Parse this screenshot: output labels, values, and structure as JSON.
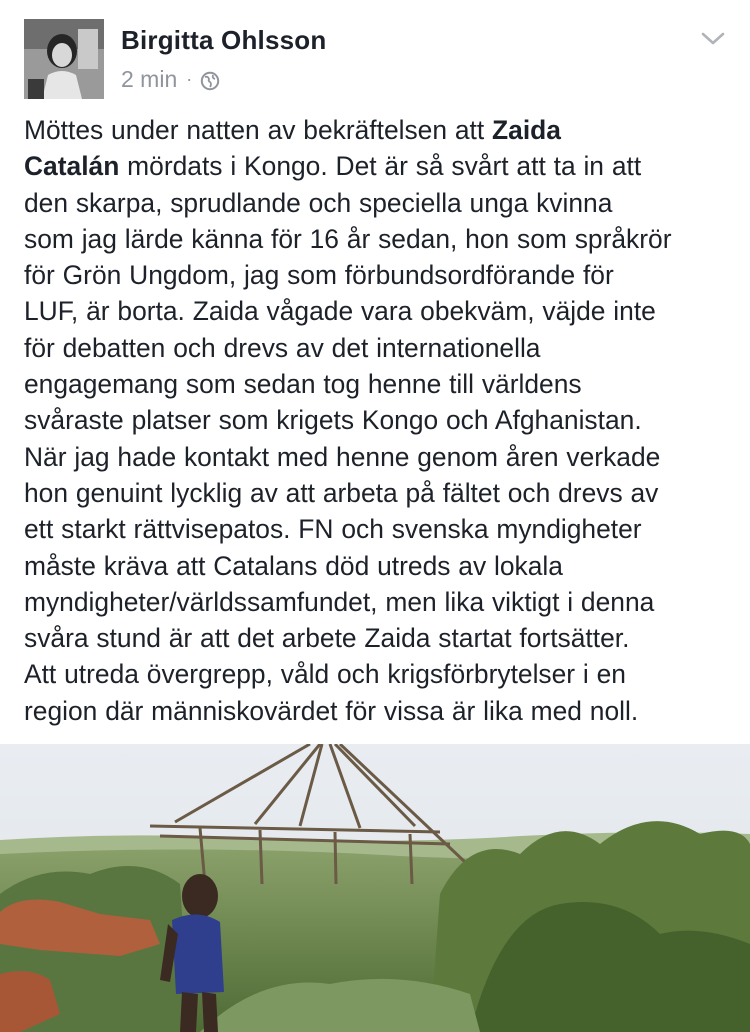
{
  "post": {
    "author": "Birgitta Ohlsson",
    "timestamp": "2 min",
    "separator": "·",
    "privacy_icon": "globe-icon",
    "menu_icon": "chevron-down-icon",
    "text": {
      "lines": [
        [
          "Möttes under natten av bekräftelsen att ",
          "Zaida"
        ],
        [
          "Catalán",
          " mördats i Kongo. Det är så svårt att ta in att"
        ],
        [
          "den skarpa, sprudlande och speciella unga kvinna"
        ],
        [
          "som jag lärde känna för 16 år sedan, hon som språkrör"
        ],
        [
          "för Grön Ungdom, jag som förbundsordförande för"
        ],
        [
          "LUF, är borta. Zaida vågade vara obekväm, väjde inte"
        ],
        [
          "för debatten och drevs av det internationella"
        ],
        [
          "engagemang som sedan tog henne till världens"
        ],
        [
          "svåraste platser som krigets Kongo och Afghanistan."
        ],
        [
          "När jag hade kontakt med henne genom åren verkade"
        ],
        [
          "hon genuint lycklig av att arbeta på fältet och drevs av"
        ],
        [
          "ett starkt rättvisepatos. FN och svenska myndigheter"
        ],
        [
          "måste kräva att Catalans död utreds av lokala"
        ],
        [
          "myndigheter/världssamfundet, men lika viktigt i denna"
        ],
        [
          "svåra stund är att det arbete Zaida startat fortsätter."
        ],
        [
          "Att utreda övergrepp, våld och krigsförbrytelser i en"
        ],
        [
          "region där människovärdet för vissa är lika med noll."
        ]
      ]
    }
  },
  "colors": {
    "text": "#1d2129",
    "meta": "#90949c",
    "background": "#ffffff"
  }
}
